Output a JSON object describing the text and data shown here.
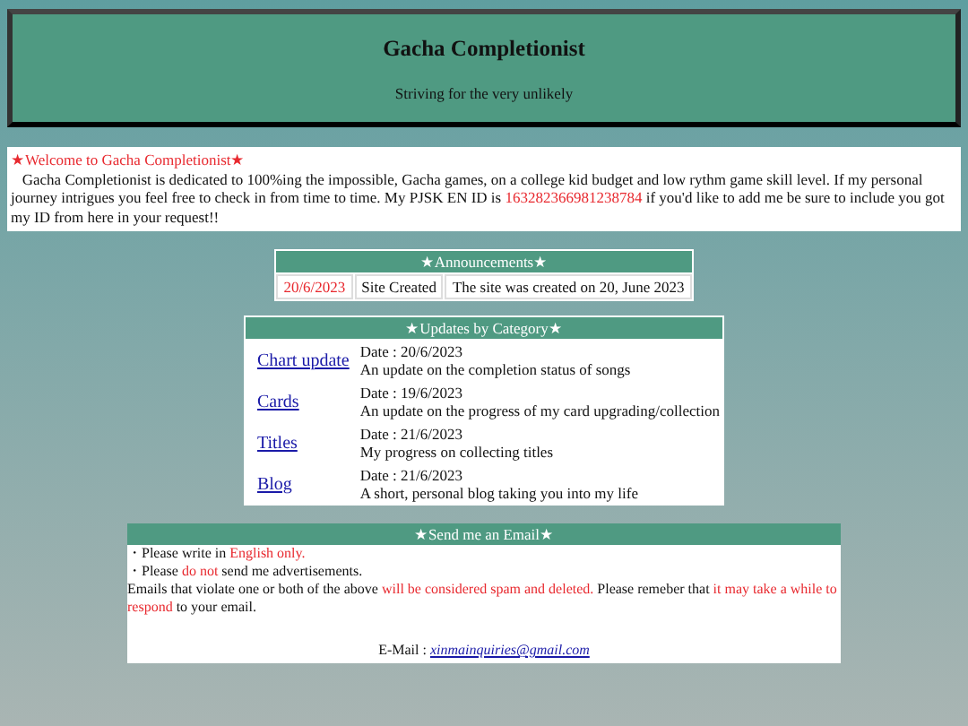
{
  "header": {
    "title": "Gacha Completionist",
    "subtitle": "Striving for the very unlikely"
  },
  "welcome": {
    "heading": "★Welcome to Gacha Completionist★",
    "paragraph": [
      {
        "text": "   Gacha Completionist is dedicated to 100%ing the impossible, Gacha games, on a college kid budget and low rythm game skill level. If my personal journey intrigues you feel free to check in from time to time. My PJSK EN ID is ",
        "highlight": false
      },
      {
        "text": "163282366981238784",
        "highlight": true
      },
      {
        "text": " if you'd like to add me be sure to include you got my ID from here in your request!!",
        "highlight": false
      }
    ]
  },
  "announcements": {
    "title": "★Announcements★",
    "rows": [
      {
        "date": "20/6/2023",
        "name": "Site Created",
        "description": "The site was created on 20, June 2023"
      }
    ]
  },
  "updates": {
    "title": "★Updates by Category★",
    "rows": [
      {
        "link": "Chart update",
        "date": "Date : 20/6/2023",
        "description": "An update on the completion status of songs"
      },
      {
        "link": "Cards",
        "date": "Date : 19/6/2023",
        "description": "An update on the progress of my card upgrading/collection"
      },
      {
        "link": "Titles",
        "date": "Date : 21/6/2023",
        "description": "My progress on collecting titles"
      },
      {
        "link": "Blog",
        "date": "Date : 21/6/2023",
        "description": "A short, personal blog taking you into my life"
      }
    ]
  },
  "email": {
    "title": "★Send me an Email★",
    "lines": [
      [
        {
          "text": "・Please write in ",
          "highlight": false
        },
        {
          "text": "English only.",
          "highlight": true
        }
      ],
      [
        {
          "text": "・Please ",
          "highlight": false
        },
        {
          "text": "do not",
          "highlight": true
        },
        {
          "text": " send me advertisements.",
          "highlight": false
        }
      ],
      [
        {
          "text": "Emails that violate one or both of the above ",
          "highlight": false
        },
        {
          "text": "will be considered spam and deleted.",
          "highlight": true
        },
        {
          "text": " Please remeber that ",
          "highlight": false
        },
        {
          "text": "it may take a while to respond",
          "highlight": true
        },
        {
          "text": " to your email.",
          "highlight": false
        }
      ]
    ],
    "address_label": "E-Mail :",
    "address": "xinmainquiries@gmail.com"
  }
}
